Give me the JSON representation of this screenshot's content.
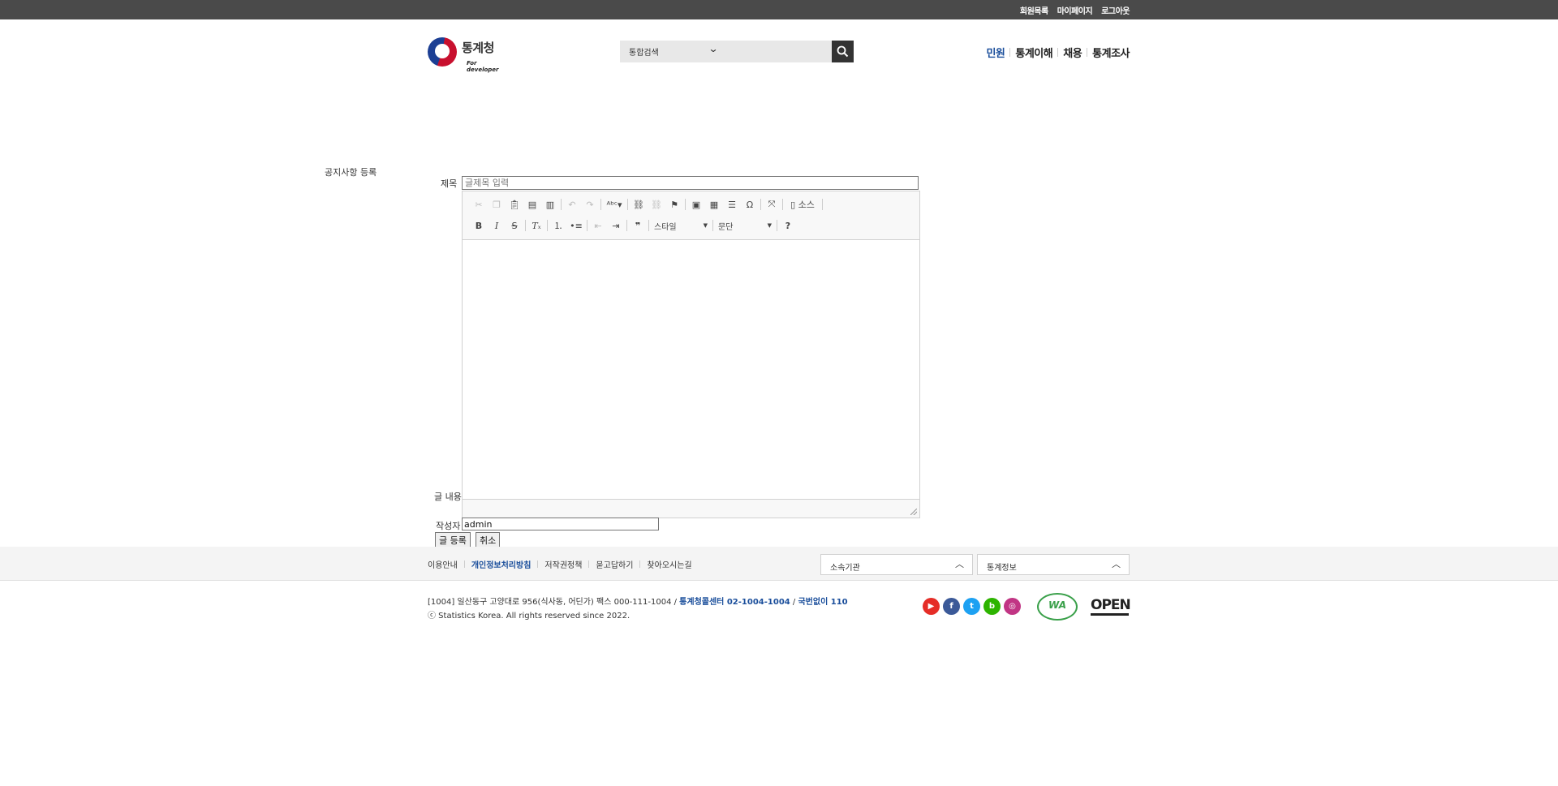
{
  "topbar": {
    "links": [
      "회원목록",
      "마이페이지",
      "로그아웃"
    ]
  },
  "header": {
    "logo_text": "통계청",
    "logo_sub": "For developer",
    "search_scope": "통합검색",
    "gnb": [
      {
        "label": "민원",
        "active": true
      },
      {
        "label": "통계이해",
        "active": false
      },
      {
        "label": "채용",
        "active": false
      },
      {
        "label": "통계조사",
        "active": false
      }
    ]
  },
  "form": {
    "page_title": "공지사항 등록",
    "title_label": "제목",
    "title_placeholder": "글제목 입력",
    "content_label": "글 내용",
    "author_label": "작성자",
    "author_value": "admin",
    "submit_label": "글 등록",
    "cancel_label": "취소"
  },
  "editor": {
    "source_label": "소스",
    "style_combo": "스타일",
    "format_combo": "문단",
    "help": "?"
  },
  "footer": {
    "links": [
      {
        "label": "이용안내",
        "highlight": false
      },
      {
        "label": "개인정보처리방침",
        "highlight": true
      },
      {
        "label": "저작권정책",
        "highlight": false
      },
      {
        "label": "묻고답하기",
        "highlight": false
      },
      {
        "label": "찾아오시는길",
        "highlight": false
      }
    ],
    "select1": "소속기관",
    "select2": "통계정보",
    "address_prefix": "[1004] 일산동구 고양대로 956(식사동, 어딘가) 팩스 000-111-1004 /",
    "address_call": "통계청콜센터 02-1004-1004",
    "address_sep": "/",
    "address_fraud": "국번없이 110",
    "copyright": "ⓒ Statistics Korea. All rights reserved since 2022.",
    "badge_wa": "WA",
    "badge_open": "OPEN",
    "sns": [
      {
        "icon": "youtube-icon",
        "color": "#e52d27",
        "glyph": "▶"
      },
      {
        "icon": "facebook-icon",
        "color": "#3b5998",
        "glyph": "f"
      },
      {
        "icon": "twitter-icon",
        "color": "#1da1f2",
        "glyph": "t"
      },
      {
        "icon": "blog-icon",
        "color": "#2db400",
        "glyph": "b"
      },
      {
        "icon": "instagram-icon",
        "color": "#c13584",
        "glyph": "◎"
      }
    ]
  },
  "colors": {
    "accent": "#1a4e9b",
    "topbar": "#4a4a4a"
  }
}
